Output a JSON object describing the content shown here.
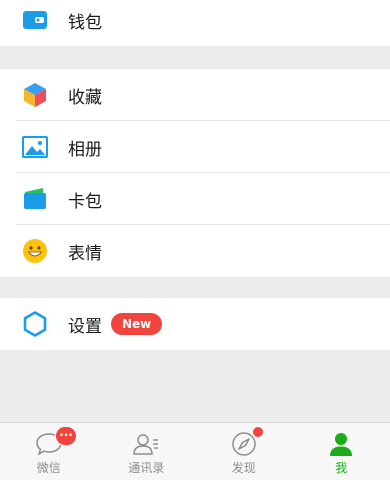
{
  "menu": {
    "wallet": {
      "label": "钱包",
      "icon": "wallet-icon"
    },
    "favorites": {
      "label": "收藏",
      "icon": "cube-icon"
    },
    "album": {
      "label": "相册",
      "icon": "photo-icon"
    },
    "cards": {
      "label": "卡包",
      "icon": "card-pack-icon"
    },
    "stickers": {
      "label": "表情",
      "icon": "smiley-icon"
    },
    "settings": {
      "label": "设置",
      "icon": "gear-icon",
      "badge": "New"
    }
  },
  "tabbar": {
    "chats": {
      "label": "微信",
      "icon": "chat-bubble-icon",
      "badge": "···"
    },
    "contacts": {
      "label": "通讯录",
      "icon": "contacts-icon"
    },
    "discover": {
      "label": "发现",
      "icon": "compass-icon",
      "dot": true
    },
    "me": {
      "label": "我",
      "icon": "person-icon",
      "active": true
    }
  },
  "colors": {
    "accent": "#1aad19",
    "badge": "#f2443e",
    "icon_blue": "#1a9ce8"
  }
}
